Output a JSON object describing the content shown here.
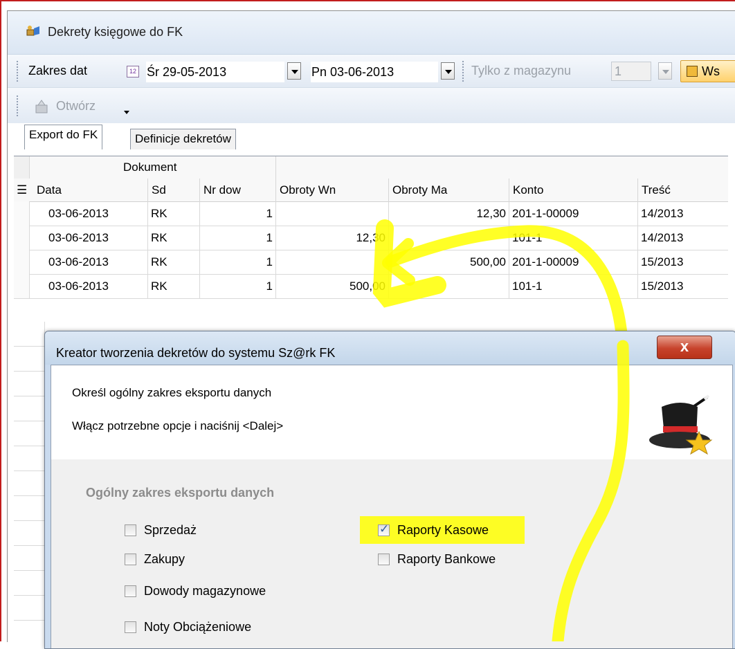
{
  "window": {
    "title": "Dekrety księgowe do FK"
  },
  "toolbar": {
    "zakres_label": "Zakres dat",
    "date_from": "Śr 29-05-2013",
    "date_to": "Pn 03-06-2013",
    "magazyn_label": "Tylko z magazynu",
    "magazyn_value": "1",
    "ws_label": "Ws",
    "open_label": "Otwórz"
  },
  "tabs": [
    "Export do FK",
    "Definicje dekretów"
  ],
  "grid": {
    "group_header": "Dokument",
    "columns": [
      "Data",
      "Sd",
      "Nr dow",
      "Obroty Wn",
      "Obroty Ma",
      "Konto",
      "Treść"
    ],
    "rows": [
      [
        "03-06-2013",
        "RK",
        "1",
        "",
        "12,30",
        "201-1-00009",
        "14/2013"
      ],
      [
        "03-06-2013",
        "RK",
        "1",
        "12,30",
        "",
        "101-1",
        "14/2013"
      ],
      [
        "03-06-2013",
        "RK",
        "1",
        "",
        "500,00",
        "201-1-00009",
        "15/2013"
      ],
      [
        "03-06-2013",
        "RK",
        "1",
        "500,00",
        "",
        "101-1",
        "15/2013"
      ]
    ]
  },
  "dialog": {
    "title": "Kreator tworzenia dekretów do systemu Sz@rk FK",
    "close": "x",
    "line1": "Określ ogólny zakres eksportu danych",
    "line2": "Włącz potrzebne opcje i naciśnij <Dalej>",
    "group_label": "Ogólny zakres eksportu danych",
    "options": [
      {
        "label": "Sprzedaż",
        "checked": false
      },
      {
        "label": "Zakupy",
        "checked": false
      },
      {
        "label": "Dowody magazynowe",
        "checked": false
      },
      {
        "label": "Noty Obciążeniowe",
        "checked": false
      },
      {
        "label": "Raporty Kasowe",
        "checked": true
      },
      {
        "label": "Raporty Bankowe",
        "checked": false
      }
    ]
  },
  "colors": {
    "highlight": "#ffff00",
    "frame_border": "#c21d1d",
    "title_gradient": "#dbe6f3"
  }
}
